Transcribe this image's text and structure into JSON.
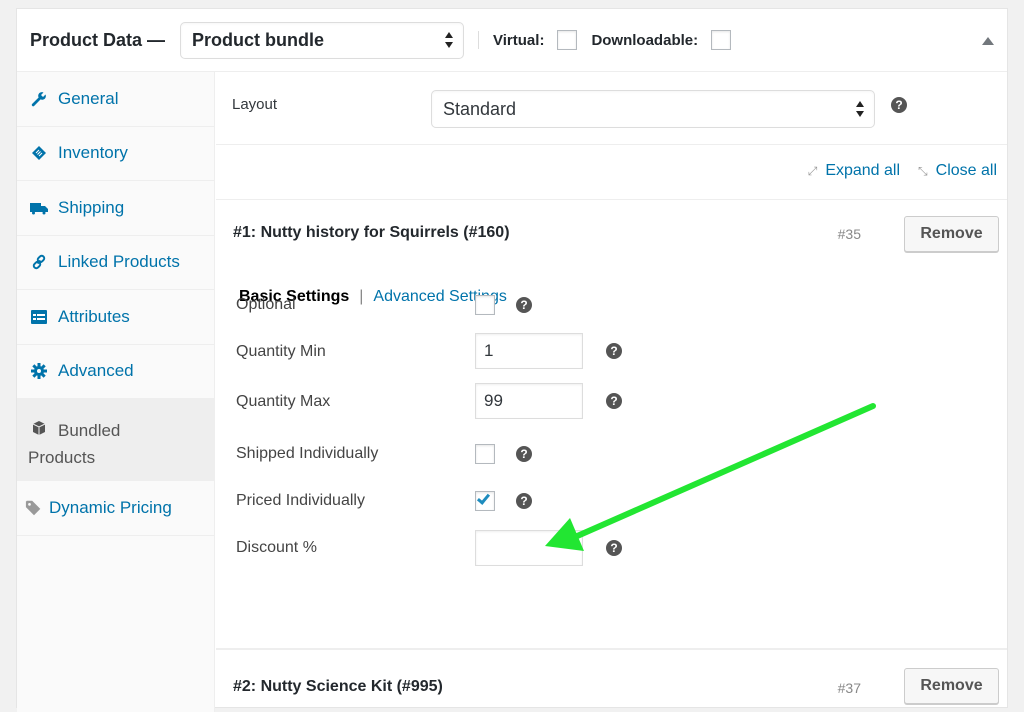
{
  "header": {
    "title": "Product Data —",
    "product_type": "Product bundle",
    "virtual_label": "Virtual:",
    "virtual_checked": false,
    "downloadable_label": "Downloadable:",
    "downloadable_checked": false
  },
  "sidebar": {
    "tabs": [
      {
        "label": "General",
        "icon": "wrench-icon"
      },
      {
        "label": "Inventory",
        "icon": "tag-icon"
      },
      {
        "label": "Shipping",
        "icon": "truck-icon"
      },
      {
        "label": "Linked Products",
        "icon": "link-icon"
      },
      {
        "label": "Attributes",
        "icon": "list-icon"
      },
      {
        "label": "Advanced",
        "icon": "gear-icon"
      },
      {
        "label_line1": "Bundled",
        "label_line2": "Products",
        "icon": "box-icon",
        "active": true
      },
      {
        "label": "Dynamic Pricing",
        "icon": "price-tag-icon"
      }
    ]
  },
  "layout": {
    "label": "Layout",
    "value": "Standard",
    "help": "?"
  },
  "toolbar": {
    "expand_all": "Expand all",
    "close_all": "Close all"
  },
  "bundled_items": [
    {
      "title": "#1: Nutty history for Squirrels (#160)",
      "id": "#35",
      "remove_label": "Remove",
      "subtabs": {
        "basic": "Basic Settings",
        "separator": "|",
        "advanced": "Advanced Settings"
      },
      "settings": {
        "optional": {
          "label": "Optional",
          "checked": false
        },
        "quantity_min": {
          "label": "Quantity Min",
          "value": "1"
        },
        "quantity_max": {
          "label": "Quantity Max",
          "value": "99"
        },
        "shipped_individually": {
          "label": "Shipped Individually",
          "checked": false
        },
        "priced_individually": {
          "label": "Priced Individually",
          "checked": true
        },
        "discount": {
          "label": "Discount %",
          "value": ""
        }
      }
    },
    {
      "title": "#2: Nutty Science Kit (#995)",
      "id": "#37",
      "remove_label": "Remove"
    }
  ],
  "annotation": {
    "arrow_color": "#22e632",
    "points_to": "Priced Individually"
  },
  "colors": {
    "link": "#0073aa",
    "checkmark": "#1e8cbe",
    "help_icon": "#555555"
  }
}
